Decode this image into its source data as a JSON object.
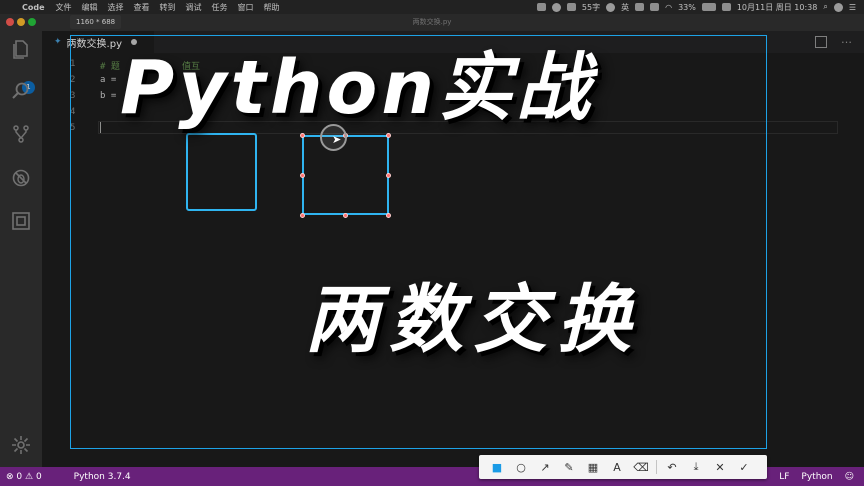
{
  "menubar": {
    "app_name": "Code",
    "items": [
      "文件",
      "编辑",
      "选择",
      "查看",
      "转到",
      "调试",
      "任务",
      "窗口",
      "帮助"
    ],
    "tray_text": "55字",
    "input_method": "英",
    "battery": "33%",
    "datetime": "10月11日 周日 10:38"
  },
  "window": {
    "title": "两数交换.py",
    "size_badge": "1160 * 688"
  },
  "activity": {
    "badge_count": "1"
  },
  "tab": {
    "label": "两数交换.py"
  },
  "editor": {
    "line_numbers": [
      "1",
      "2",
      "3",
      "4",
      "5"
    ],
    "lines": [
      {
        "text": "# 题",
        "tail": "两个",
        "tail2": "值互",
        "comment": true
      },
      {
        "text": "a ="
      },
      {
        "text": "b ="
      },
      {
        "text": ""
      },
      {
        "text": ""
      }
    ]
  },
  "overlay": {
    "title": "Python实战",
    "subtitle": "两数交换"
  },
  "snip_toolbar": {
    "tools": [
      {
        "icon": "rectangle-icon",
        "glyph": "■"
      },
      {
        "icon": "ellipse-icon",
        "glyph": "○"
      },
      {
        "icon": "arrow-icon",
        "glyph": "↗"
      },
      {
        "icon": "pencil-icon",
        "glyph": "✎"
      },
      {
        "icon": "mosaic-icon",
        "glyph": "▦"
      },
      {
        "icon": "text-icon",
        "glyph": "A"
      },
      {
        "icon": "eraser-icon",
        "glyph": "⌫"
      }
    ],
    "actions": [
      {
        "icon": "undo-icon",
        "glyph": "↶"
      },
      {
        "icon": "download-icon",
        "glyph": "⤓"
      },
      {
        "icon": "close-icon",
        "glyph": "✕"
      },
      {
        "icon": "confirm-icon",
        "glyph": "✓"
      }
    ],
    "accent": "#1a9be6"
  },
  "statusbar": {
    "errors": "0",
    "warnings": "0",
    "interpreter": "Python 3.7.4",
    "eol": "LF",
    "language": "Python",
    "color": "#68217a"
  }
}
